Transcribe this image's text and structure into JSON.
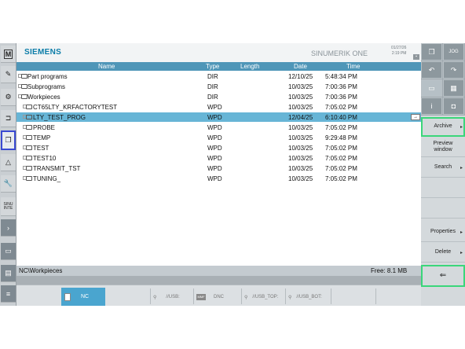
{
  "header": {
    "brand": "SIEMENS",
    "product": "SINUMERIK ONE",
    "date": "01/27/26",
    "time": "2:19 PM"
  },
  "columns": [
    "Name",
    "Type",
    "Length",
    "Date",
    "Time"
  ],
  "rows": [
    {
      "name": "Part programs",
      "type": "DIR",
      "length": "",
      "date": "12/10/25",
      "time": "5:48:34 PM"
    },
    {
      "name": "Subprograms",
      "type": "DIR",
      "length": "",
      "date": "10/03/25",
      "time": "7:00:36 PM"
    },
    {
      "name": "Workpieces",
      "type": "DIR",
      "length": "",
      "date": "10/03/25",
      "time": "7:00:36 PM"
    },
    {
      "name": "CT65LTY_KRFACTORYTEST",
      "type": "WPD",
      "length": "",
      "date": "10/03/25",
      "time": "7:05:02 PM"
    },
    {
      "name": "LTY_TEST_PROG",
      "type": "WPD",
      "length": "",
      "date": "12/04/25",
      "time": "6:10:40 PM"
    },
    {
      "name": "PROBE",
      "type": "WPD",
      "length": "",
      "date": "10/03/25",
      "time": "7:05:02 PM"
    },
    {
      "name": "TEMP",
      "type": "WPD",
      "length": "",
      "date": "10/03/25",
      "time": "9:29:48 PM"
    },
    {
      "name": "TEST",
      "type": "WPD",
      "length": "",
      "date": "10/03/25",
      "time": "7:05:02 PM"
    },
    {
      "name": "TEST10",
      "type": "WPD",
      "length": "",
      "date": "10/03/25",
      "time": "7:05:02 PM"
    },
    {
      "name": "TRANSMIT_TST",
      "type": "WPD",
      "length": "",
      "date": "10/03/25",
      "time": "7:05:02 PM"
    },
    {
      "name": "TUNING_",
      "type": "WPD",
      "length": "",
      "date": "10/03/25",
      "time": "7:05:02 PM"
    }
  ],
  "path": "NC\\Workpieces",
  "free": "Free: 8.1 MB",
  "bottom": {
    "nc": "NC",
    "usb": "//USB:",
    "dnc": "DNC",
    "usb_top": "//USB_TOP:",
    "usb_bot": "//USB_BOT:"
  },
  "left": {
    "m": "M",
    "sinumerik": "SINU INTE"
  },
  "softkeys": {
    "archive": "Archive",
    "preview": "Preview window",
    "search": "Search",
    "properties": "Properties",
    "delete": "Delete"
  },
  "right_top": {
    "jog": "JOG",
    "info": "i"
  },
  "colors": {
    "accent": "#4f96b8",
    "selected": "#67b5d6",
    "brand": "#0a7ca8",
    "highlight": "#3ad67a",
    "left_selected": "#3a4ad1"
  }
}
